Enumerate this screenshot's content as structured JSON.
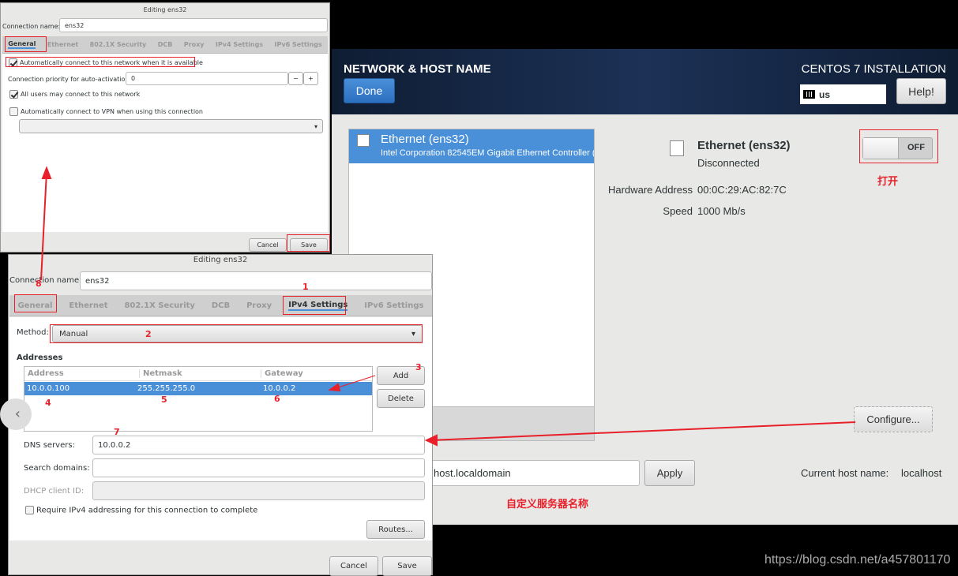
{
  "dialog1": {
    "title": "Editing ens32",
    "conn_label": "Connection name:",
    "conn_value": "ens32",
    "tabs": [
      "General",
      "Ethernet",
      "802.1X Security",
      "DCB",
      "Proxy",
      "IPv4 Settings",
      "IPv6 Settings"
    ],
    "auto_connect": "Automatically connect to this network when it is available",
    "priority_label": "Connection priority for auto-activation:",
    "priority_value": "0",
    "minus": "−",
    "plus": "+",
    "all_users": "All users may connect to this network",
    "vpn": "Automatically connect to VPN when using this connection",
    "cancel": "Cancel",
    "save": "Save"
  },
  "dialog2": {
    "title": "Editing ens32",
    "conn_label": "Connection name:",
    "conn_value": "ens32",
    "tabs": [
      "General",
      "Ethernet",
      "802.1X Security",
      "DCB",
      "Proxy",
      "IPv4 Settings",
      "IPv6 Settings"
    ],
    "method_label": "Method:",
    "method_value": "Manual",
    "addresses_label": "Addresses",
    "columns": [
      "Address",
      "Netmask",
      "Gateway"
    ],
    "rows": [
      [
        "10.0.0.100",
        "255.255.255.0",
        "10.0.0.2"
      ]
    ],
    "add": "Add",
    "delete": "Delete",
    "dns_label": "DNS servers:",
    "dns_value": "10.0.0.2",
    "search_label": "Search domains:",
    "search_value": "",
    "dhcp_label": "DHCP client ID:",
    "dhcp_value": "",
    "require": "Require IPv4 addressing for this connection to complete",
    "routes": "Routes...",
    "cancel": "Cancel",
    "save": "Save"
  },
  "installer": {
    "header_title": "NETWORK & HOST NAME",
    "done": "Done",
    "product": "CENTOS 7 INSTALLATION",
    "keyboard": "us",
    "help": "Help!",
    "device_name": "Ethernet (ens32)",
    "device_desc": "Intel Corporation 82545EM Gigabit Ethernet Controller (",
    "detail_name": "Ethernet (ens32)",
    "status": "Disconnected",
    "hw_label": "Hardware Address",
    "hw_value": "00:0C:29:AC:82:7C",
    "speed_label": "Speed",
    "speed_value": "1000 Mb/s",
    "toggle": "OFF",
    "toggle_on": false,
    "configure": "Configure...",
    "hostname_value": "host.localdomain",
    "apply": "Apply",
    "current_label": "Current host name:",
    "current_value": "localhost"
  },
  "annotations": {
    "open": "打开",
    "custom_name": "自定义服务器名称",
    "n1": "1",
    "n2": "2",
    "n3": "3",
    "n4": "4",
    "n5": "5",
    "n6": "6",
    "n7": "7",
    "n8": "8",
    "accent": "#e8202a"
  },
  "watermark": "https://blog.csdn.net/a457801170"
}
